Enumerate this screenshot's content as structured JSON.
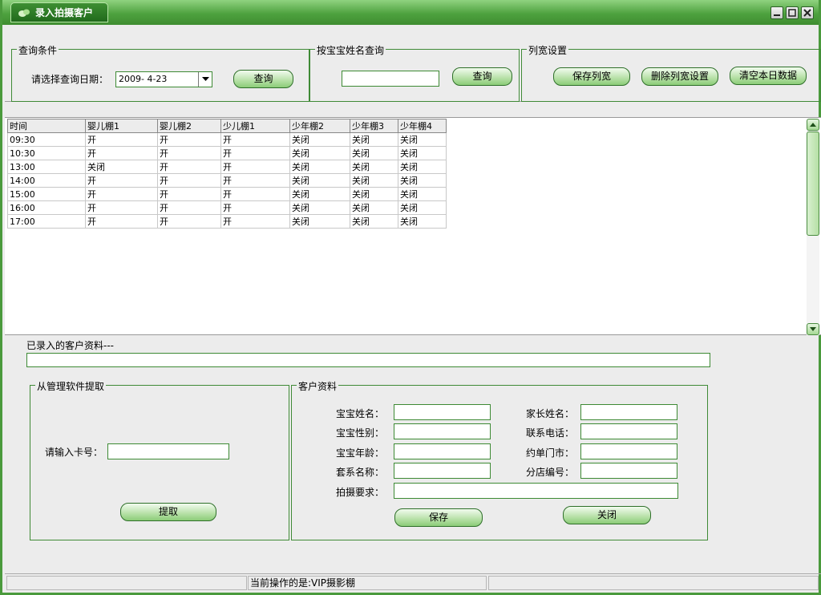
{
  "window": {
    "title": "录入拍摄客户"
  },
  "query_conditions": {
    "legend": "查询条件",
    "date_label": "请选择查询日期：",
    "date_value": "2009- 4-23",
    "query_button": "查询"
  },
  "name_search": {
    "legend": "按宝宝姓名查询",
    "input_value": "",
    "query_button": "查询"
  },
  "column_settings": {
    "legend": "列宽设置",
    "save_button": "保存列宽",
    "delete_button": "删除列宽设置",
    "clear_button": "清空本日数据"
  },
  "grid": {
    "columns": [
      "时间",
      "婴儿棚1",
      "婴儿棚2",
      "少儿棚1",
      "少年棚2",
      "少年棚3",
      "少年棚4"
    ],
    "rows": [
      [
        "09:30",
        "开",
        "开",
        "开",
        "关闭",
        "关闭",
        "关闭"
      ],
      [
        "10:30",
        "开",
        "开",
        "开",
        "关闭",
        "关闭",
        "关闭"
      ],
      [
        "13:00",
        "关闭",
        "开",
        "开",
        "关闭",
        "关闭",
        "关闭"
      ],
      [
        "14:00",
        "开",
        "开",
        "开",
        "关闭",
        "关闭",
        "关闭"
      ],
      [
        "15:00",
        "开",
        "开",
        "开",
        "关闭",
        "关闭",
        "关闭"
      ],
      [
        "16:00",
        "开",
        "开",
        "开",
        "关闭",
        "关闭",
        "关闭"
      ],
      [
        "17:00",
        "开",
        "开",
        "开",
        "关闭",
        "关闭",
        "关闭"
      ]
    ]
  },
  "entered_info": {
    "label": "已录入的客户资料---",
    "value": ""
  },
  "fetch_panel": {
    "legend": "从管理软件提取",
    "card_label": "请输入卡号：",
    "card_value": "",
    "fetch_button": "提取"
  },
  "customer_panel": {
    "legend": "客户资料",
    "baby_name_label": "宝宝姓名：",
    "baby_gender_label": "宝宝性别：",
    "baby_age_label": "宝宝年龄：",
    "package_label": "套系名称：",
    "requirement_label": "拍摄要求：",
    "parent_name_label": "家长姓名：",
    "phone_label": "联系电话：",
    "store_label": "约单门市：",
    "branch_label": "分店编号：",
    "save_button": "保存",
    "close_button": "关闭"
  },
  "status": {
    "current_operation": "当前操作的是:VIP摄影棚"
  },
  "colors": {
    "accent": "#4ea23f",
    "border_green": "#3f8a36",
    "panel_bg": "#ececec"
  }
}
